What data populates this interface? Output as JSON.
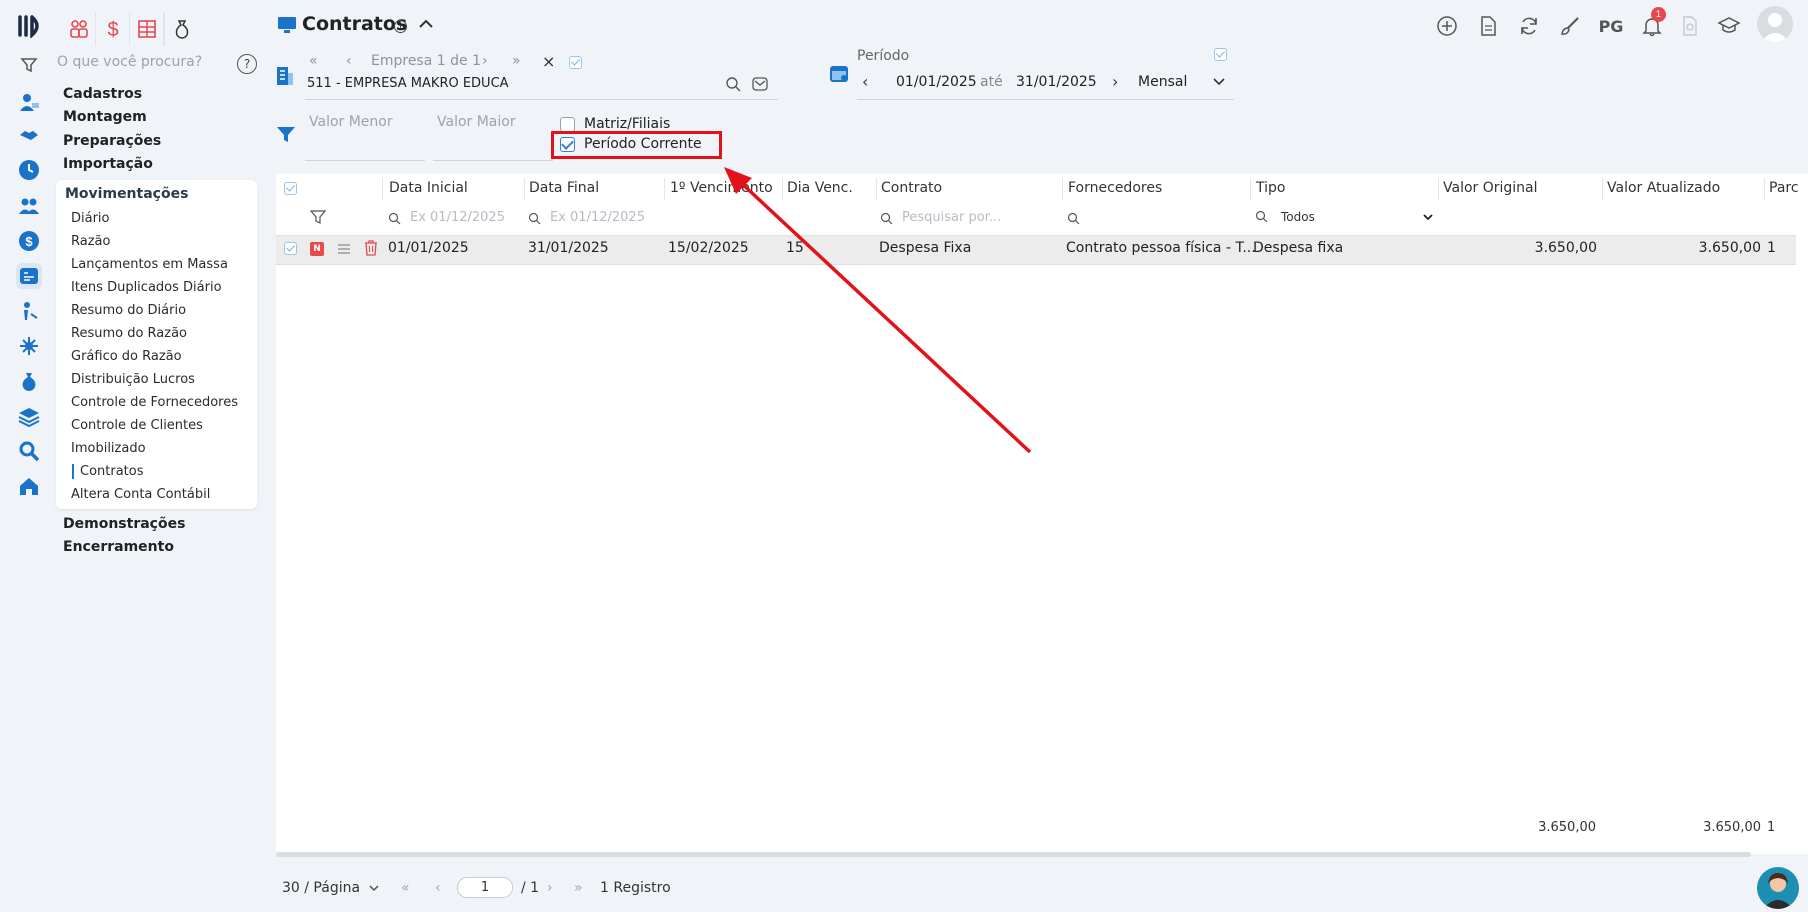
{
  "search": {
    "placeholder": "O que você procura?",
    "help": "?"
  },
  "menu": {
    "top_items": [
      "Cadastros",
      "Montagem",
      "Preparações",
      "Importação"
    ],
    "section": "Movimentações",
    "sub_items": [
      "Diário",
      "Razão",
      "Lançamentos em Massa",
      "Itens Duplicados Diário",
      "Resumo do Diário",
      "Resumo do Razão",
      "Gráfico do Razão",
      "Distribuição Lucros",
      "Controle de Fornecedores",
      "Controle de Clientes",
      "Imobilizado",
      "Contratos",
      "Altera Conta Contábil"
    ],
    "bottom_items": [
      "Demonstrações",
      "Encerramento"
    ]
  },
  "header": {
    "title": "Contratos",
    "user_initials": "PG",
    "notifications": "1"
  },
  "empresa": {
    "nav": "Empresa 1 de 1",
    "name": "511 - EMPRESA MAKRO EDUCA"
  },
  "periodo": {
    "label": "Período",
    "start": "01/01/2025",
    "sep": "até",
    "end": "31/01/2025",
    "mode": "Mensal"
  },
  "filters": {
    "valor_menor": "Valor Menor",
    "valor_maior": "Valor Maior",
    "matriz": "Matriz/Filiais",
    "periodo_corrente": "Período Corrente"
  },
  "table": {
    "columns": [
      "Data Inicial",
      "Data Final",
      "1º Vencimento",
      "Dia Venc.",
      "Contrato",
      "Fornecedores",
      "Tipo",
      "Valor Original",
      "Valor Atualizado",
      "Parc"
    ],
    "filter_placeholders": {
      "data_inicial": "Ex 01/12/2025",
      "data_final": "Ex 01/12/2025",
      "contrato": "Pesquisar por...",
      "tipo": "Todos"
    },
    "rows": [
      {
        "badge": "N",
        "data_inicial": "01/01/2025",
        "data_final": "31/01/2025",
        "vencimento": "15/02/2025",
        "dia": "15",
        "contrato": "Despesa Fixa",
        "fornecedores": "Contrato pessoa física - T...",
        "tipo": "Despesa fixa",
        "valor_original": "3.650,00",
        "valor_atualizado": "3.650,00",
        "parc": "1"
      }
    ],
    "totals": {
      "valor_original": "3.650,00",
      "valor_atualizado": "3.650,00",
      "parc": "1"
    }
  },
  "pager": {
    "per_page": "30 / Página",
    "page": "1",
    "of": "/ 1",
    "records": "1 Registro"
  },
  "colors": {
    "accent": "#1a73c9",
    "highlight": "#e3121a",
    "badge": "#e64b4b"
  }
}
